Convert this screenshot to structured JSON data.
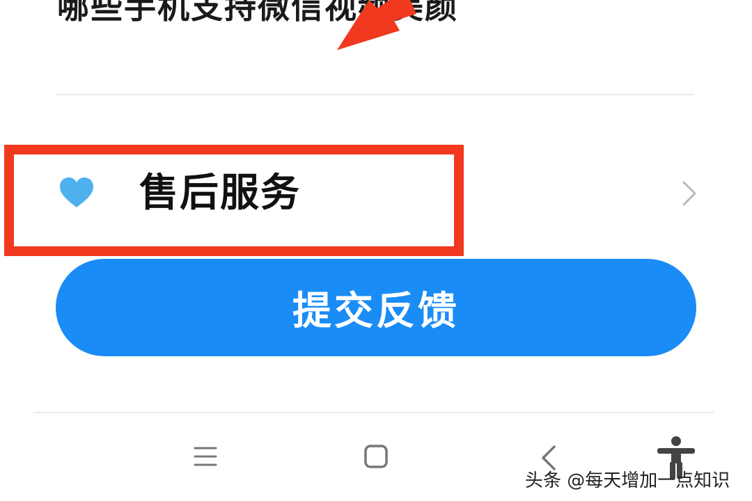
{
  "header": {
    "title": "哪些手机支持微信视频美颜"
  },
  "service_row": {
    "label": "售后服务",
    "icon": "heart-icon",
    "chevron": "chevron-right-icon"
  },
  "submit": {
    "label": "提交反馈"
  },
  "nav": {
    "items": [
      "menu-icon",
      "home-icon",
      "back-icon",
      "accessibility-icon"
    ]
  },
  "watermark": {
    "text": "头条 @每天增加一点知识"
  },
  "colors": {
    "accent": "#1a8cf5",
    "heart": "#4fb0f0",
    "highlight": "#f0391f"
  }
}
